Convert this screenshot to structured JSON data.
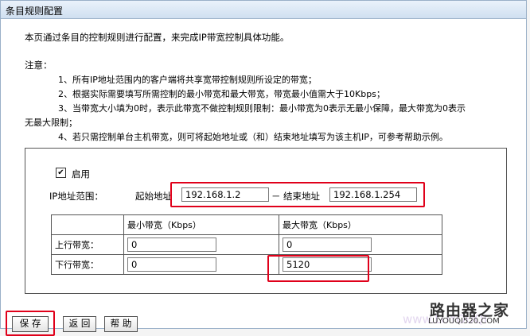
{
  "page": {
    "title": "条目规则配置",
    "intro": "本页通过条目的控制规则进行配置，来完成IP带宽控制具体功能。",
    "notice_label": "注意：",
    "notes": [
      "1、所有IP地址范围内的客户端将共享宽带控制规则所设定的带宽；",
      "2、根据实际需要填写所需控制的最小带宽和最大带宽，带宽最小值需大于10Kbps；",
      "3、当带宽大小填为0时，表示此带宽不做控制规则限制：最小带宽为0表示无最小保障，最大带宽为0表示",
      "无最大限制；",
      "4、若只需控制单台主机带宽，则可将起始地址或（和）结束地址填写为该主机IP，可参考帮助示例。"
    ]
  },
  "form": {
    "enable": {
      "label": "启用",
      "checked": true,
      "check_glyph": "✔"
    },
    "ip_range_label": "IP地址范围：",
    "start_label": "起始地址",
    "start_value": "192.168.1.2",
    "separator": "－",
    "end_label": "结束地址",
    "end_value": "192.168.1.254",
    "bandwidth": {
      "headers": [
        "",
        "最小带宽（Kbps）",
        "最大带宽（Kbps）"
      ],
      "rows": [
        {
          "label": "上行带宽：",
          "min": "0",
          "max": "0"
        },
        {
          "label": "下行带宽：",
          "min": "0",
          "max": "5120"
        }
      ]
    }
  },
  "buttons": {
    "save": "保 存",
    "back": "返 回",
    "help": "帮 助"
  },
  "watermark": {
    "name": "路由器之家",
    "url": "LUYOUQI520.COM",
    "faint": "www.LUYOUQI"
  },
  "colors": {
    "highlight": "#e0001a",
    "title_bar": "#cfdff0"
  }
}
